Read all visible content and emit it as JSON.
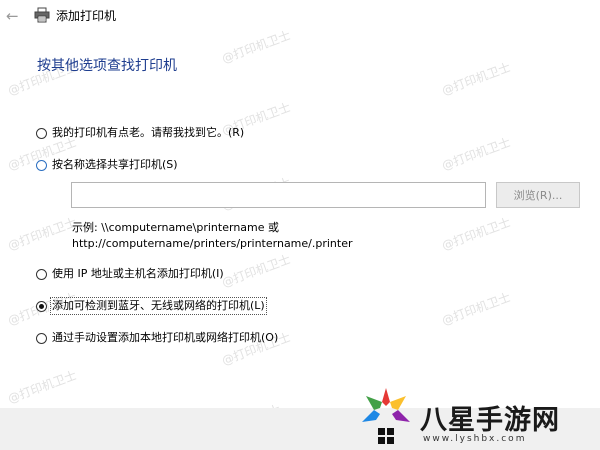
{
  "window": {
    "title": "添加打印机"
  },
  "page": {
    "heading": "按其他选项查找打印机"
  },
  "options": [
    {
      "label": "我的打印机有点老。请帮我找到它。(R)",
      "selected": false
    },
    {
      "label": "按名称选择共享打印机(S)",
      "selected": false
    },
    {
      "label": "使用 IP 地址或主机名添加打印机(I)",
      "selected": false
    },
    {
      "label": "添加可检测到蓝牙、无线或网络的打印机(L)",
      "selected": true
    },
    {
      "label": "通过手动设置添加本地打印机或网络打印机(O)",
      "selected": false
    }
  ],
  "shared_printer": {
    "input_value": "",
    "browse_label": "浏览(R)...",
    "example_line1": "示例: \\\\computername\\printername 或",
    "example_line2": "http://computername/printers/printername/.printer"
  },
  "watermark": {
    "text": "@打印机卫士"
  },
  "logo": {
    "text": "八星手游网",
    "url": "www.lyshbx.com"
  },
  "colors": {
    "heading": "#1e3d8f",
    "footer_bg": "#f0f0f0"
  }
}
